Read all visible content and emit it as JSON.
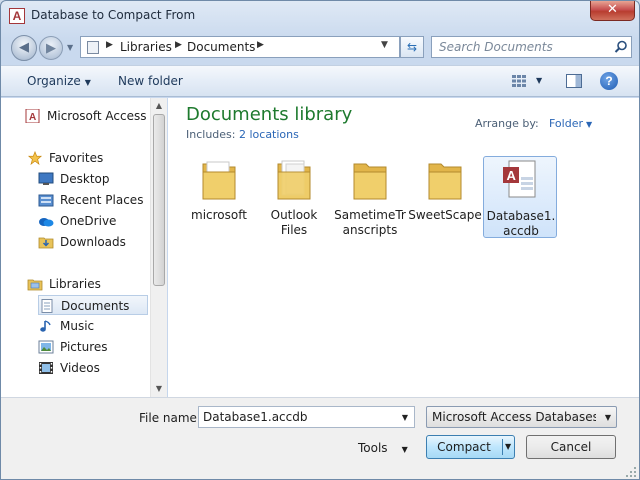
{
  "window": {
    "title": "Database to Compact From",
    "close_glyph": "✕",
    "app_icon_letter": "A"
  },
  "address": {
    "crumbs": [
      "Libraries",
      "Documents"
    ]
  },
  "search": {
    "placeholder": "Search Documents"
  },
  "toolbar": {
    "organize": "Organize",
    "new_folder": "New folder"
  },
  "nav": {
    "items": [
      {
        "label": "Microsoft Access",
        "icon": "access-icon"
      },
      {
        "label": "Favorites",
        "icon": "star-icon"
      },
      {
        "label": "Desktop",
        "icon": "desktop-icon"
      },
      {
        "label": "Recent Places",
        "icon": "recent-places-icon"
      },
      {
        "label": "OneDrive",
        "icon": "cloud-icon"
      },
      {
        "label": "Downloads",
        "icon": "downloads-icon"
      },
      {
        "label": "Libraries",
        "icon": "libraries-icon"
      },
      {
        "label": "Documents",
        "icon": "documents-icon",
        "selected": true
      },
      {
        "label": "Music",
        "icon": "music-icon"
      },
      {
        "label": "Pictures",
        "icon": "pictures-icon"
      },
      {
        "label": "Videos",
        "icon": "videos-icon"
      }
    ]
  },
  "content": {
    "title": "Documents library",
    "includes_label": "Includes:",
    "includes_link": "2 locations",
    "arrange_label": "Arrange by:",
    "arrange_value": "Folder",
    "files": [
      {
        "name": "microsoft",
        "type": "folder"
      },
      {
        "name": "Outlook Files",
        "type": "folder"
      },
      {
        "name": "SametimeTranscripts",
        "type": "folder"
      },
      {
        "name": "SweetScape",
        "type": "folder"
      },
      {
        "name": "Database1.accdb",
        "type": "access-file",
        "selected": true
      }
    ]
  },
  "bottom": {
    "file_name_label": "File name:",
    "file_name_value": "Database1.accdb",
    "file_type": "Microsoft Access Databases (*.r",
    "tools": "Tools",
    "compact": "Compact",
    "cancel": "Cancel"
  }
}
